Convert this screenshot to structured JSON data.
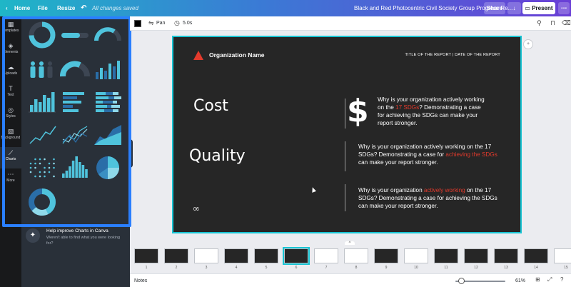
{
  "topbar": {
    "home": "Home",
    "file": "File",
    "resize": "Resize",
    "status": "All changes saved",
    "doc_title": "Black and Red Photocentric Civil Society Group Progress Re...",
    "share": "Share",
    "present": "Present",
    "icons": [
      "chevron-left-icon",
      "undo-icon",
      "download-icon",
      "more-icon"
    ]
  },
  "rail": {
    "items": [
      {
        "label": "Templates",
        "icon": "▦"
      },
      {
        "label": "Elements",
        "icon": "◈"
      },
      {
        "label": "Uploads",
        "icon": "☁"
      },
      {
        "label": "Text",
        "icon": "T"
      },
      {
        "label": "Styles",
        "icon": "◎"
      },
      {
        "label": "Background",
        "icon": "▧"
      },
      {
        "label": "Charts",
        "icon": "⟋"
      },
      {
        "label": "More",
        "icon": "⋯"
      }
    ],
    "active": "Charts"
  },
  "panel": {
    "chart_tiles": [
      "donut-chart",
      "progress-bar",
      "half-gauge",
      "people-infographic",
      "half-donut-gauge",
      "area-column-chart",
      "bar-chart",
      "horizontal-bar-chart",
      "stacked-horizontal-bar-chart",
      "line-chart",
      "multi-line-chart",
      "area-chart",
      "dot-plot",
      "column-chart",
      "pie-chart",
      "ring-chart"
    ],
    "colors": {
      "accent": "#4fc3dc",
      "accent_dark": "#2a6ea8",
      "track": "#3d4653"
    },
    "help_title": "Help improve Charts in Canva",
    "help_desc": "Weren't able to find what you were looking for?"
  },
  "editor_toolbar": {
    "pan": "Pan",
    "duration": "5.0s"
  },
  "slide": {
    "org_name": "Organization Name",
    "report_title": "TITLE OF THE REPORT | DATE OF THE REPORT",
    "cost": "Cost",
    "quality": "Quality",
    "dollar": "$",
    "page_number": "06",
    "p1": {
      "a": "Why is your organization actively working on the ",
      "b": "17 SDGs",
      "c": "? Demonstrating a case for achieving the SDGs can make your report stronger."
    },
    "p2": {
      "a": "Why is your organization actively working on the 17 SDGs? Demonstrating a case for ",
      "b": "achieving the SDGs",
      "c": " can make your report stronger."
    },
    "p3": {
      "a": "Why is your organization ",
      "b": "actively working",
      "c": " on the 17 SDGs? Demonstrating a case for achieving the SDGs can make your report stronger."
    },
    "colors": {
      "background": "#262626",
      "accent": "#e33a2c",
      "selection": "#18c4d3"
    }
  },
  "filmstrip": {
    "pages": [
      "1",
      "2",
      "3",
      "4",
      "5",
      "6",
      "7",
      "8",
      "9",
      "10",
      "11",
      "12",
      "13",
      "14",
      "15"
    ],
    "selected": "6"
  },
  "bottombar": {
    "notes": "Notes",
    "zoom": "61%"
  }
}
